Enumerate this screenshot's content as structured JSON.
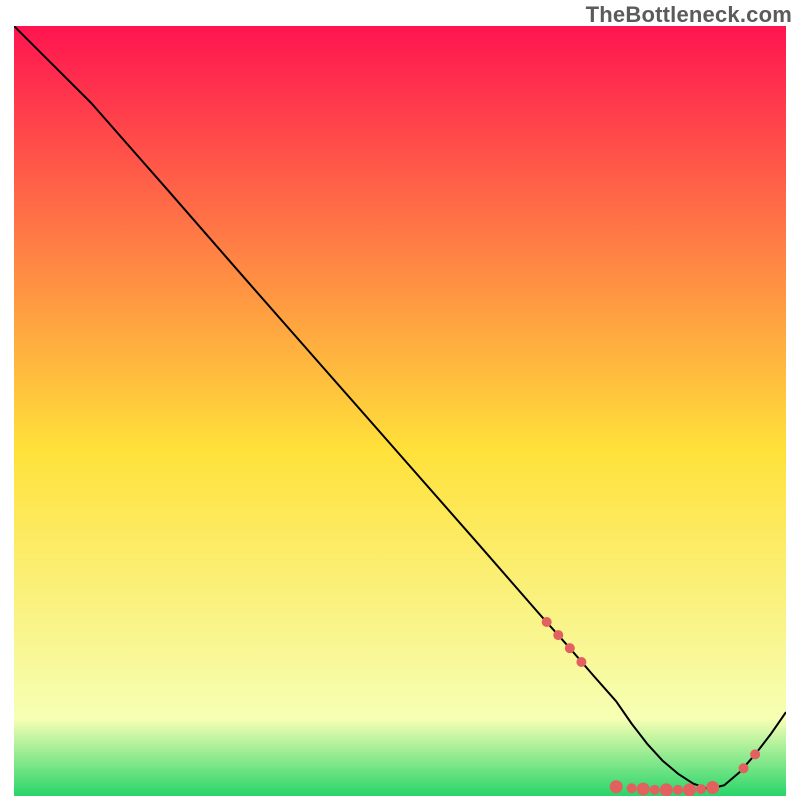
{
  "watermark": "TheBottleneck.com",
  "chart_data": {
    "type": "line",
    "title": "",
    "xlabel": "",
    "ylabel": "",
    "xlim": [
      0,
      100
    ],
    "ylim": [
      0,
      100
    ],
    "grid": false,
    "legend": false,
    "background_gradient": {
      "top_color": "#ff1450",
      "mid_color": "#ffe13a",
      "bottom1_color": "#f6ffb4",
      "bottom2_color": "#28d56a"
    },
    "series": [
      {
        "name": "curve",
        "stroke": "#000000",
        "x": [
          0,
          4,
          10,
          20,
          30,
          40,
          50,
          60,
          68,
          72,
          75,
          78,
          80,
          82,
          84,
          86,
          88,
          90,
          92,
          94,
          96,
          98,
          100
        ],
        "y": [
          100,
          96,
          90,
          78.6,
          67.1,
          55.7,
          44.3,
          32.9,
          23.7,
          19.2,
          15.7,
          12.3,
          9.4,
          6.8,
          4.6,
          2.9,
          1.6,
          0.9,
          1.4,
          3.1,
          5.4,
          8.0,
          10.9
        ]
      }
    ],
    "markers": {
      "name": "dots",
      "fill": "#e2605f",
      "radius_small": 5,
      "radius_large": 6.5,
      "points": [
        {
          "x": 69.0,
          "y": 22.6,
          "r": "s"
        },
        {
          "x": 70.5,
          "y": 20.9,
          "r": "s"
        },
        {
          "x": 72.0,
          "y": 19.2,
          "r": "s"
        },
        {
          "x": 73.5,
          "y": 17.4,
          "r": "s"
        },
        {
          "x": 78.0,
          "y": 1.2,
          "r": "l"
        },
        {
          "x": 80.0,
          "y": 1.0,
          "r": "s"
        },
        {
          "x": 81.5,
          "y": 0.9,
          "r": "l"
        },
        {
          "x": 83.0,
          "y": 0.8,
          "r": "s"
        },
        {
          "x": 84.5,
          "y": 0.8,
          "r": "l"
        },
        {
          "x": 86.0,
          "y": 0.8,
          "r": "s"
        },
        {
          "x": 87.5,
          "y": 0.8,
          "r": "l"
        },
        {
          "x": 89.0,
          "y": 0.9,
          "r": "s"
        },
        {
          "x": 90.5,
          "y": 1.1,
          "r": "l"
        },
        {
          "x": 94.5,
          "y": 3.6,
          "r": "s"
        },
        {
          "x": 96.0,
          "y": 5.4,
          "r": "s"
        }
      ]
    }
  }
}
